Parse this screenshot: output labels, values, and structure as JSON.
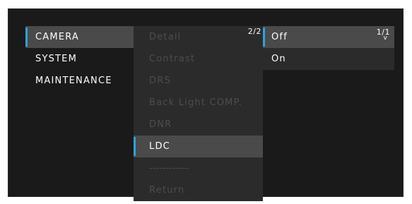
{
  "menu": {
    "main_items": [
      {
        "label": "CAMERA"
      },
      {
        "label": "SYSTEM"
      },
      {
        "label": "MAINTENANCE"
      }
    ],
    "sub_page": "2/2",
    "sub_items": [
      {
        "label": "Detail"
      },
      {
        "label": "Contrast"
      },
      {
        "label": "DRS"
      },
      {
        "label": "Back Light COMP."
      },
      {
        "label": "DNR"
      },
      {
        "label": "LDC"
      },
      {
        "label": "------------"
      },
      {
        "label": "Return"
      }
    ],
    "option_page": "1/1",
    "option_more_arrow": "v",
    "option_items": [
      {
        "label": "Off"
      },
      {
        "label": "On"
      }
    ]
  },
  "colors": {
    "accent": "#2ea3d9",
    "screen_bg": "#1a1a1a",
    "selected_bg": "#4a4a4a",
    "panel_bg": "#2b2b2b",
    "disabled_text": "#4d4d4d"
  }
}
